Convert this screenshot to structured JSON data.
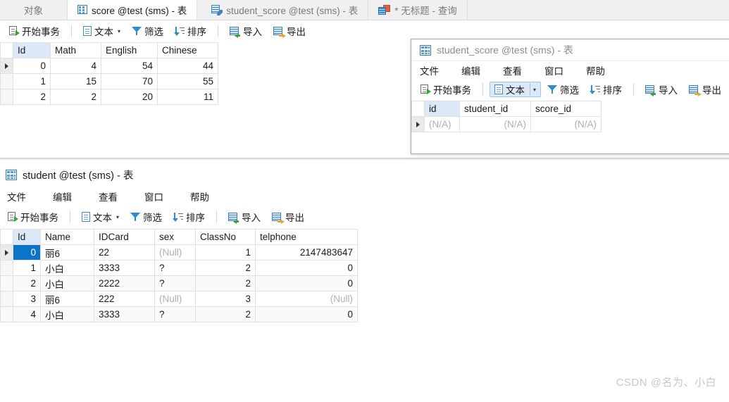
{
  "tabs": [
    {
      "label": "对象",
      "icon": "none",
      "active": false
    },
    {
      "label": "score @test (sms) - 表",
      "icon": "table-icon",
      "active": true
    },
    {
      "label": "student_score @test (sms) - 表",
      "icon": "table-edit-icon",
      "active": false
    },
    {
      "label": "* 无标题 - 查询",
      "icon": "query-icon",
      "active": false
    }
  ],
  "toolbar": {
    "begin_transaction": "开始事务",
    "text": "文本",
    "filter": "筛选",
    "sort": "排序",
    "import": "导入",
    "export": "导出"
  },
  "menubar": {
    "file": "文件",
    "edit": "编辑",
    "view": "查看",
    "window": "窗口",
    "help": "帮助"
  },
  "score_grid": {
    "columns": [
      "Id",
      "Math",
      "English",
      "Chinese"
    ],
    "rows": [
      {
        "Id": "0",
        "Math": "4",
        "English": "54",
        "Chinese": "44",
        "current": true
      },
      {
        "Id": "1",
        "Math": "15",
        "English": "70",
        "Chinese": "55",
        "current": false
      },
      {
        "Id": "2",
        "Math": "2",
        "English": "20",
        "Chinese": "11",
        "current": false
      }
    ]
  },
  "child_window": {
    "title": "student_score @test (sms) - 表",
    "grid": {
      "columns": [
        "id",
        "student_id",
        "score_id"
      ],
      "rows": [
        {
          "id": "(N/A)",
          "student_id": "(N/A)",
          "score_id": "(N/A)",
          "current": true
        }
      ]
    }
  },
  "student_window": {
    "title": "student @test (sms) - 表",
    "grid": {
      "columns": [
        "Id",
        "Name",
        "IDCard",
        "sex",
        "ClassNo",
        "telphone"
      ],
      "rows": [
        {
          "Id": "0",
          "Name": "丽6",
          "IDCard": "22",
          "sex": "(Null)",
          "ClassNo": "1",
          "telphone": "2147483647",
          "current": true
        },
        {
          "Id": "1",
          "Name": "小白",
          "IDCard": "3333",
          "sex": "?",
          "ClassNo": "2",
          "telphone": "0",
          "current": false
        },
        {
          "Id": "2",
          "Name": "小白",
          "IDCard": "2222",
          "sex": "?",
          "ClassNo": "2",
          "telphone": "0",
          "current": false
        },
        {
          "Id": "3",
          "Name": "丽6",
          "IDCard": "222",
          "sex": "(Null)",
          "ClassNo": "3",
          "telphone": "(Null)",
          "current": false
        },
        {
          "Id": "4",
          "Name": "小白",
          "IDCard": "3333",
          "sex": "?",
          "ClassNo": "2",
          "telphone": "0",
          "current": false
        }
      ]
    }
  },
  "watermark": "CSDN @名为、小白",
  "colors": {
    "selection": "#0a74c8",
    "key_column": "#dbe8f7",
    "null_text": "#b0b0b0",
    "accent_blue": "#2e8bd0"
  }
}
